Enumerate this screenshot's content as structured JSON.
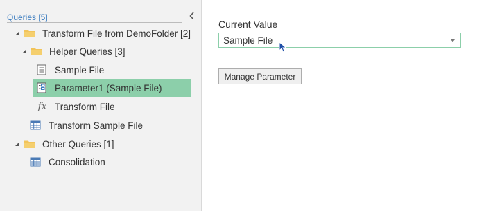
{
  "queries_pane": {
    "header": "Queries [5]",
    "tree": [
      {
        "label": "Transform File from DemoFolder [2]",
        "icon": "folder-icon",
        "expander": "expanded-triangle-icon"
      },
      {
        "label": "Helper Queries [3]",
        "icon": "folder-icon",
        "expander": "expanded-triangle-icon"
      },
      {
        "label": "Sample File",
        "icon": "document-icon"
      },
      {
        "label": "Parameter1 (Sample File)",
        "icon": "parameter-icon",
        "selected": true
      },
      {
        "label": "Transform File",
        "icon": "function-icon",
        "glyph": "fx"
      },
      {
        "label": "Transform Sample File",
        "icon": "table-icon"
      },
      {
        "label": "Other Queries [1]",
        "icon": "folder-icon",
        "expander": "expanded-triangle-icon"
      },
      {
        "label": "Consolidation",
        "icon": "table-icon"
      }
    ]
  },
  "parameter_panel": {
    "current_value_label": "Current Value",
    "current_value": "Sample File",
    "manage_button": "Manage Parameter"
  },
  "colors": {
    "selection": "#8ccfaa",
    "pane_background": "#f2f2f2",
    "folder": "#f2c45a",
    "header_text": "#3a7bbf",
    "cursor": "#1f4fa8"
  }
}
